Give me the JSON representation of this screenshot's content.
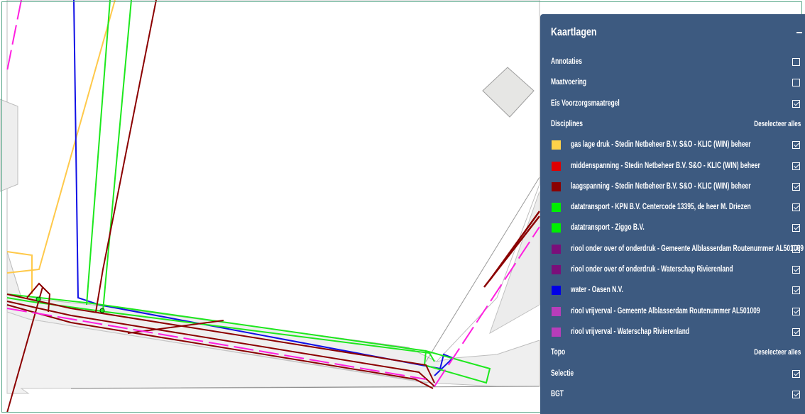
{
  "panel": {
    "title": "Kaartlagen",
    "rows": [
      {
        "label": "Annotaties",
        "checked": false
      },
      {
        "label": "Maatvoering",
        "checked": false
      },
      {
        "label": "Eis Voorzorgsmaatregel",
        "checked": true
      }
    ],
    "disciplines": {
      "header": "Disciplines",
      "deselect_label": "Deselecteer alles",
      "layers": [
        {
          "label": "gas lage druk - Stedin Netbeheer B.V. S&O - KLIC (WIN) beheer",
          "color": "#ffd24a",
          "checked": true
        },
        {
          "label": "middenspanning - Stedin Netbeheer B.V. S&O - KLIC (WIN) beheer",
          "color": "#e00000",
          "checked": true
        },
        {
          "label": "laagspanning - Stedin Netbeheer B.V. S&O - KLIC (WIN) beheer",
          "color": "#8b0000",
          "checked": true
        },
        {
          "label": "datatransport - KPN B.V. Centercode 13395, de heer M. Driezen",
          "color": "#00ee00",
          "checked": true
        },
        {
          "label": "datatransport - Ziggo B.V.",
          "color": "#00ee00",
          "checked": true
        },
        {
          "label": "riool onder over of onderdruk - Gemeente Alblasserdam Routenummer AL501009",
          "color": "#7a0f7a",
          "checked": true
        },
        {
          "label": "riool onder over of onderdruk - Waterschap Rivierenland",
          "color": "#7a0f7a",
          "checked": true
        },
        {
          "label": "water - Oasen N.V.",
          "color": "#0000e6",
          "checked": true
        },
        {
          "label": "riool vrijverval - Gemeente Alblasserdam Routenummer AL501009",
          "color": "#b83dba",
          "checked": true
        },
        {
          "label": "riool vrijverval - Waterschap Rivierenland",
          "color": "#b83dba",
          "checked": true
        }
      ]
    },
    "topo": {
      "header": "Topo",
      "deselect_label": "Deselecteer alles",
      "layers": [
        {
          "label": "Selectie",
          "checked": true
        },
        {
          "label": "BGT",
          "checked": true
        }
      ]
    }
  }
}
